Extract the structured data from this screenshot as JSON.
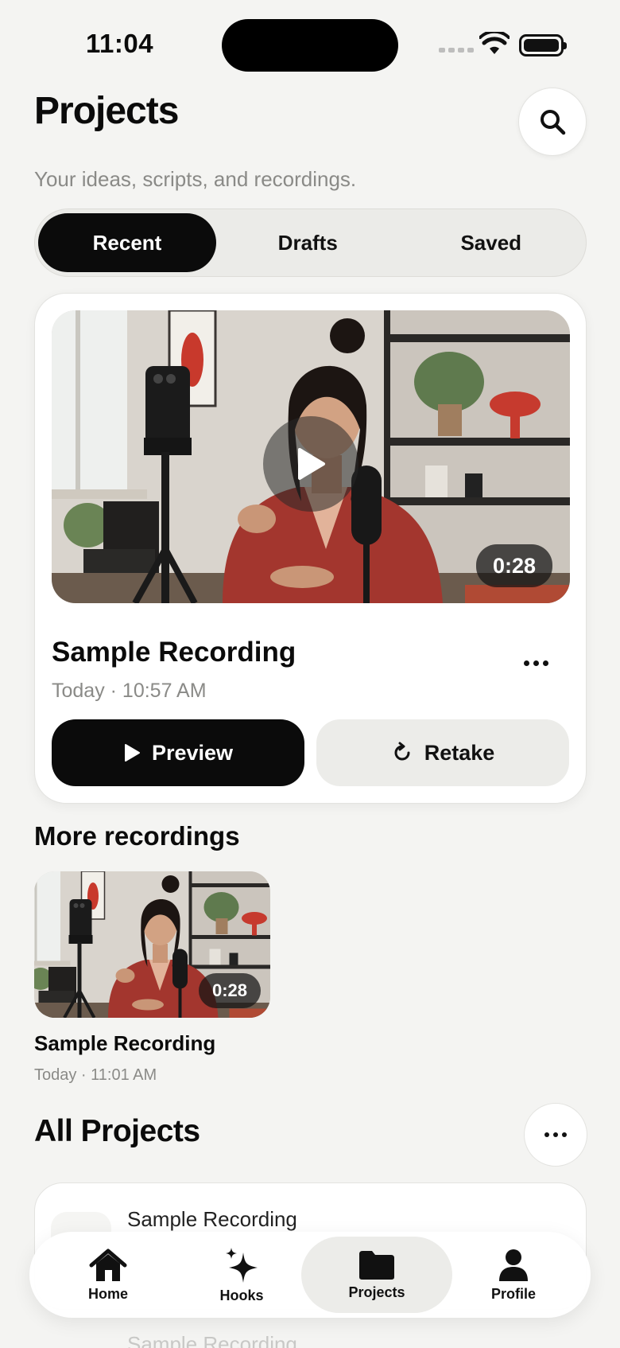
{
  "status_bar": {
    "time": "11:04"
  },
  "header": {
    "title": "Projects",
    "subtitle": "Your ideas, scripts, and recordings."
  },
  "segments": {
    "items": [
      {
        "label": "Recent",
        "active": true
      },
      {
        "label": "Drafts",
        "active": false
      },
      {
        "label": "Saved",
        "active": false
      }
    ]
  },
  "featured": {
    "title": "Sample Recording",
    "meta": "Today · 10:57 AM",
    "duration": "0:28",
    "preview_label": "Preview",
    "retake_label": "Retake"
  },
  "more_recordings": {
    "section_title": "More recordings",
    "items": [
      {
        "title": "Sample Recording",
        "meta": "Today · 11:01 AM",
        "duration": "0:28"
      }
    ]
  },
  "all_projects": {
    "section_title": "All Projects",
    "rows": [
      {
        "title": "Sample Recording"
      },
      {
        "title": "Sample Recording"
      }
    ]
  },
  "tab_bar": {
    "items": [
      {
        "label": "Home",
        "icon": "home-icon",
        "active": false
      },
      {
        "label": "Hooks",
        "icon": "sparkle-icon",
        "active": false
      },
      {
        "label": "Projects",
        "icon": "folder-icon",
        "active": true
      },
      {
        "label": "Profile",
        "icon": "person-icon",
        "active": false
      }
    ]
  },
  "colors": {
    "background": "#f4f4f2",
    "primary": "#0b0b0b",
    "muted_text": "#8a8a87",
    "shirt_red": "#a3362e"
  }
}
